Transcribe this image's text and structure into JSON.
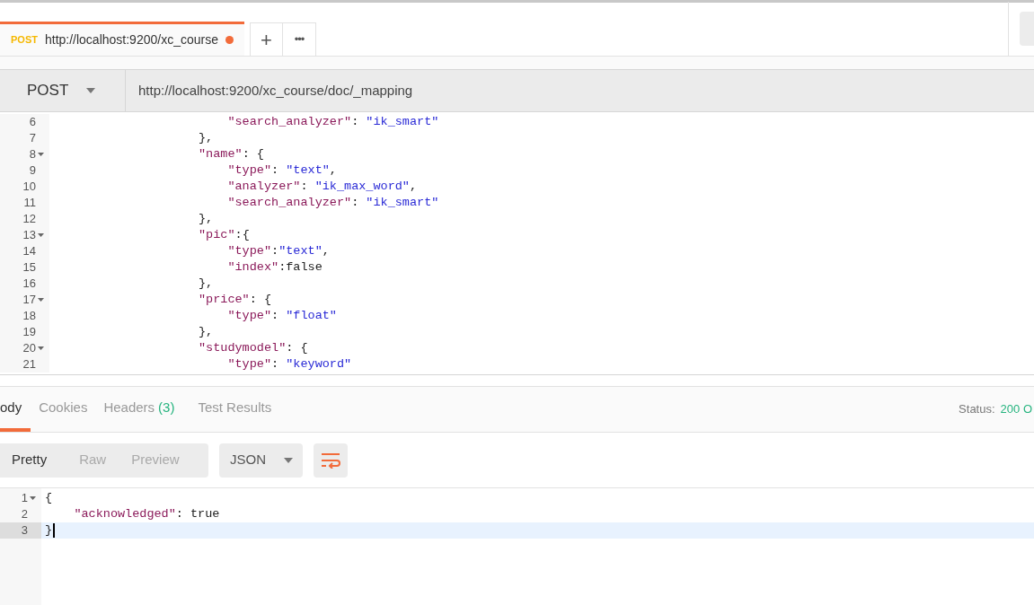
{
  "request_tabs": [
    {
      "method": "POST",
      "url": "http://localhost:9200/xc_course",
      "selected": true,
      "unsaved": true
    }
  ],
  "new_tab_label": "+",
  "more_label": "•••",
  "request": {
    "method": "POST",
    "url": "http://localhost:9200/xc_course/doc/_mapping"
  },
  "body_editor": {
    "lines": [
      {
        "number": "6",
        "foldable": false,
        "kind": "attribute",
        "tokens": [
          {
            "kind": "key",
            "text": "\"search_analyzer\""
          },
          {
            "kind": "plain",
            "text": ": "
          },
          {
            "kind": "string",
            "text": "\"ik_smart\""
          }
        ]
      },
      {
        "number": "7",
        "foldable": false,
        "kind": "property",
        "tokens": [
          {
            "kind": "plain",
            "text": "},"
          }
        ]
      },
      {
        "number": "8",
        "foldable": true,
        "kind": "property",
        "tokens": [
          {
            "kind": "key",
            "text": "\"name\""
          },
          {
            "kind": "plain",
            "text": ": {"
          }
        ]
      },
      {
        "number": "9",
        "foldable": false,
        "kind": "attribute",
        "tokens": [
          {
            "kind": "key",
            "text": "\"type\""
          },
          {
            "kind": "plain",
            "text": ": "
          },
          {
            "kind": "string",
            "text": "\"text\""
          },
          {
            "kind": "plain",
            "text": ","
          }
        ]
      },
      {
        "number": "10",
        "foldable": false,
        "kind": "attribute",
        "tokens": [
          {
            "kind": "key",
            "text": "\"analyzer\""
          },
          {
            "kind": "plain",
            "text": ": "
          },
          {
            "kind": "string",
            "text": "\"ik_max_word\""
          },
          {
            "kind": "plain",
            "text": ","
          }
        ]
      },
      {
        "number": "11",
        "foldable": false,
        "kind": "attribute",
        "tokens": [
          {
            "kind": "key",
            "text": "\"search_analyzer\""
          },
          {
            "kind": "plain",
            "text": ": "
          },
          {
            "kind": "string",
            "text": "\"ik_smart\""
          }
        ]
      },
      {
        "number": "12",
        "foldable": false,
        "kind": "property",
        "tokens": [
          {
            "kind": "plain",
            "text": "},"
          }
        ]
      },
      {
        "number": "13",
        "foldable": true,
        "kind": "property",
        "tokens": [
          {
            "kind": "key",
            "text": "\"pic\""
          },
          {
            "kind": "plain",
            "text": ":{"
          }
        ]
      },
      {
        "number": "14",
        "foldable": false,
        "kind": "attribute",
        "tokens": [
          {
            "kind": "key",
            "text": "\"type\""
          },
          {
            "kind": "plain",
            "text": ":"
          },
          {
            "kind": "string",
            "text": "\"text\""
          },
          {
            "kind": "plain",
            "text": ","
          }
        ]
      },
      {
        "number": "15",
        "foldable": false,
        "kind": "attribute",
        "tokens": [
          {
            "kind": "key",
            "text": "\"index\""
          },
          {
            "kind": "plain",
            "text": ":false"
          }
        ]
      },
      {
        "number": "16",
        "foldable": false,
        "kind": "property",
        "tokens": [
          {
            "kind": "plain",
            "text": "},"
          }
        ]
      },
      {
        "number": "17",
        "foldable": true,
        "kind": "property",
        "tokens": [
          {
            "kind": "key",
            "text": "\"price\""
          },
          {
            "kind": "plain",
            "text": ": {"
          }
        ]
      },
      {
        "number": "18",
        "foldable": false,
        "kind": "attribute",
        "tokens": [
          {
            "kind": "key",
            "text": "\"type\""
          },
          {
            "kind": "plain",
            "text": ": "
          },
          {
            "kind": "string",
            "text": "\"float\""
          }
        ]
      },
      {
        "number": "19",
        "foldable": false,
        "kind": "property",
        "tokens": [
          {
            "kind": "plain",
            "text": "},"
          }
        ]
      },
      {
        "number": "20",
        "foldable": true,
        "kind": "property",
        "tokens": [
          {
            "kind": "key",
            "text": "\"studymodel\""
          },
          {
            "kind": "plain",
            "text": ": {"
          }
        ]
      },
      {
        "number": "21",
        "foldable": false,
        "kind": "attribute",
        "tokens": [
          {
            "kind": "key",
            "text": "\"type\""
          },
          {
            "kind": "plain",
            "text": ": "
          },
          {
            "kind": "string",
            "text": "\"keyword\""
          }
        ]
      }
    ]
  },
  "response_tabs": [
    {
      "label": "ody",
      "selected": true
    },
    {
      "label": "Cookies",
      "selected": false
    },
    {
      "label": "Headers",
      "count": "(3)",
      "selected": false
    },
    {
      "label": "Test Results",
      "selected": false
    }
  ],
  "status": {
    "label": "Status:",
    "value": "200 O"
  },
  "view_modes": [
    {
      "label": "Pretty",
      "selected": true
    },
    {
      "label": "Raw",
      "selected": false
    },
    {
      "label": "Preview",
      "selected": false
    }
  ],
  "format": "JSON",
  "response_editor": {
    "lines": [
      {
        "number": "1",
        "foldable": true,
        "current": false,
        "kind": "brace",
        "tokens": [
          {
            "kind": "plain",
            "text": "{"
          }
        ]
      },
      {
        "number": "2",
        "foldable": false,
        "current": false,
        "kind": "member",
        "tokens": [
          {
            "kind": "key",
            "text": "\"acknowledged\""
          },
          {
            "kind": "plain",
            "text": ": true"
          }
        ]
      },
      {
        "number": "3",
        "foldable": false,
        "current": true,
        "kind": "brace",
        "tokens": [
          {
            "kind": "plain",
            "text": "}"
          }
        ]
      }
    ]
  }
}
